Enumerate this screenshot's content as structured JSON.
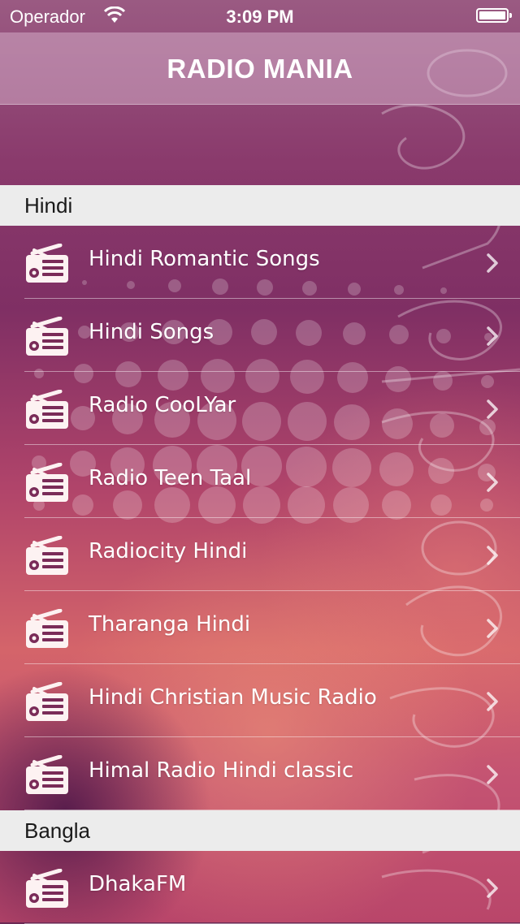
{
  "status_bar": {
    "carrier": "Operador",
    "time": "3:09 PM",
    "wifi_icon": "wifi-icon",
    "battery_icon": "battery-full-icon"
  },
  "nav": {
    "title": "RADIO MANIA"
  },
  "colors": {
    "section_header_bg": "#ececec",
    "row_text": "#ffffff",
    "icon_fill": "#fdf2f2",
    "background_top": "#8a3a6c",
    "background_bottom": "#d4646a"
  },
  "icons": {
    "station": "radio-icon",
    "disclosure": "chevron-right-icon"
  },
  "sections": [
    {
      "title": "Hindi",
      "stations": [
        "Hindi Romantic Songs",
        "Hindi Songs",
        "Radio CooLYar",
        "Radio Teen Taal",
        "Radiocity Hindi",
        "Tharanga Hindi",
        "Hindi Christian Music Radio",
        "Himal Radio Hindi classic"
      ]
    },
    {
      "title": "Bangla",
      "stations": [
        "DhakaFM"
      ]
    }
  ]
}
